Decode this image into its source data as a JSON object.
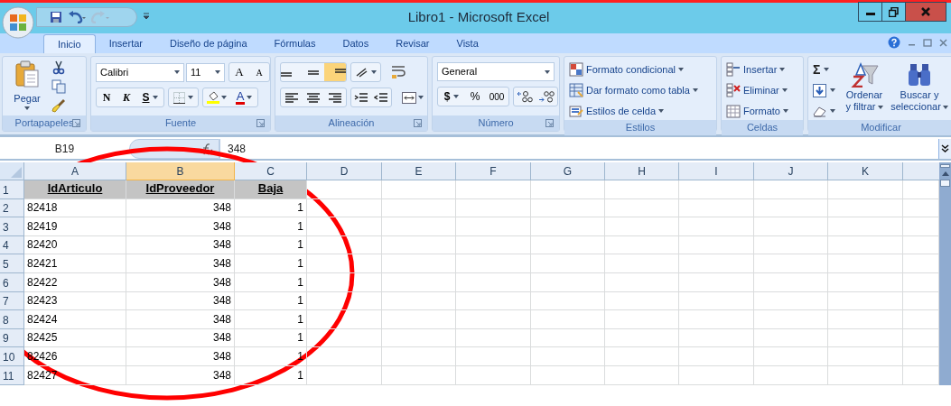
{
  "window": {
    "title": "Libro1 - Microsoft Excel"
  },
  "tabs": [
    {
      "label": "Inicio",
      "selected": true
    },
    {
      "label": "Insertar",
      "selected": false
    },
    {
      "label": "Diseño de página",
      "selected": false
    },
    {
      "label": "Fórmulas",
      "selected": false
    },
    {
      "label": "Datos",
      "selected": false
    },
    {
      "label": "Revisar",
      "selected": false
    },
    {
      "label": "Vista",
      "selected": false
    }
  ],
  "ribbon": {
    "groups": [
      {
        "label": "Portapapeles",
        "launcher": true
      },
      {
        "label": "Fuente",
        "launcher": true
      },
      {
        "label": "Alineación",
        "launcher": true
      },
      {
        "label": "Número",
        "launcher": true
      },
      {
        "label": "Estilos",
        "launcher": false
      },
      {
        "label": "Celdas",
        "launcher": false
      },
      {
        "label": "Modificar",
        "launcher": false
      }
    ],
    "paste": "Pegar",
    "font_name": "Calibri",
    "font_size": "11",
    "grow_font": "A",
    "shrink_font": "A",
    "bold": "N",
    "italic": "K",
    "underline": "S",
    "font_color": "A",
    "vertical_align": [
      {
        "selected": false
      },
      {
        "selected": false
      },
      {
        "selected": true
      }
    ],
    "number_format": "General",
    "currency": "$",
    "percent": "%",
    "thousands": "000",
    "styles": [
      "Formato condicional",
      "Dar formato como tabla",
      "Estilos de celda"
    ],
    "cells": [
      "Insertar",
      "Eliminar",
      "Formato"
    ],
    "autosum": "Σ",
    "sort": [
      "Ordenar",
      "y filtrar"
    ],
    "find": [
      "Buscar y",
      "seleccionar"
    ]
  },
  "formula_bar": {
    "name_box": "B19",
    "formula": "348"
  },
  "sheet": {
    "columns": [
      {
        "label": "A",
        "selected": false
      },
      {
        "label": "B",
        "selected": true
      },
      {
        "label": "C",
        "selected": false
      },
      {
        "label": "D",
        "selected": false
      },
      {
        "label": "E",
        "selected": false
      },
      {
        "label": "F",
        "selected": false
      },
      {
        "label": "G",
        "selected": false
      },
      {
        "label": "H",
        "selected": false
      },
      {
        "label": "I",
        "selected": false
      },
      {
        "label": "J",
        "selected": false
      },
      {
        "label": "K",
        "selected": false
      }
    ],
    "rows": [
      {
        "number": "1",
        "cells": [
          {
            "kind": "heading",
            "value": "IdArticulo"
          },
          {
            "kind": "heading",
            "value": "IdProveedor"
          },
          {
            "kind": "heading",
            "value": "Baja"
          }
        ]
      },
      {
        "number": "2",
        "cells": [
          {
            "kind": "text",
            "value": "82418"
          },
          {
            "kind": "number",
            "value": "348"
          },
          {
            "kind": "number",
            "value": "1"
          }
        ]
      },
      {
        "number": "3",
        "cells": [
          {
            "kind": "text",
            "value": "82419"
          },
          {
            "kind": "number",
            "value": "348"
          },
          {
            "kind": "number",
            "value": "1"
          }
        ]
      },
      {
        "number": "4",
        "cells": [
          {
            "kind": "text",
            "value": "82420"
          },
          {
            "kind": "number",
            "value": "348"
          },
          {
            "kind": "number",
            "value": "1"
          }
        ]
      },
      {
        "number": "5",
        "cells": [
          {
            "kind": "text",
            "value": "82421"
          },
          {
            "kind": "number",
            "value": "348"
          },
          {
            "kind": "number",
            "value": "1"
          }
        ]
      },
      {
        "number": "6",
        "cells": [
          {
            "kind": "text",
            "value": "82422"
          },
          {
            "kind": "number",
            "value": "348"
          },
          {
            "kind": "number",
            "value": "1"
          }
        ]
      },
      {
        "number": "7",
        "cells": [
          {
            "kind": "text",
            "value": "82423"
          },
          {
            "kind": "number",
            "value": "348"
          },
          {
            "kind": "number",
            "value": "1"
          }
        ]
      },
      {
        "number": "8",
        "cells": [
          {
            "kind": "text",
            "value": "82424"
          },
          {
            "kind": "number",
            "value": "348"
          },
          {
            "kind": "number",
            "value": "1"
          }
        ]
      },
      {
        "number": "9",
        "cells": [
          {
            "kind": "text",
            "value": "82425"
          },
          {
            "kind": "number",
            "value": "348"
          },
          {
            "kind": "number",
            "value": "1"
          }
        ]
      },
      {
        "number": "10",
        "cells": [
          {
            "kind": "text",
            "value": "82426"
          },
          {
            "kind": "number",
            "value": "348"
          },
          {
            "kind": "number",
            "value": "1"
          }
        ]
      },
      {
        "number": "11",
        "cells": [
          {
            "kind": "text",
            "value": "82427"
          },
          {
            "kind": "number",
            "value": "348"
          },
          {
            "kind": "number",
            "value": "1"
          }
        ]
      }
    ]
  },
  "annotation": {
    "kind": "ellipse"
  }
}
